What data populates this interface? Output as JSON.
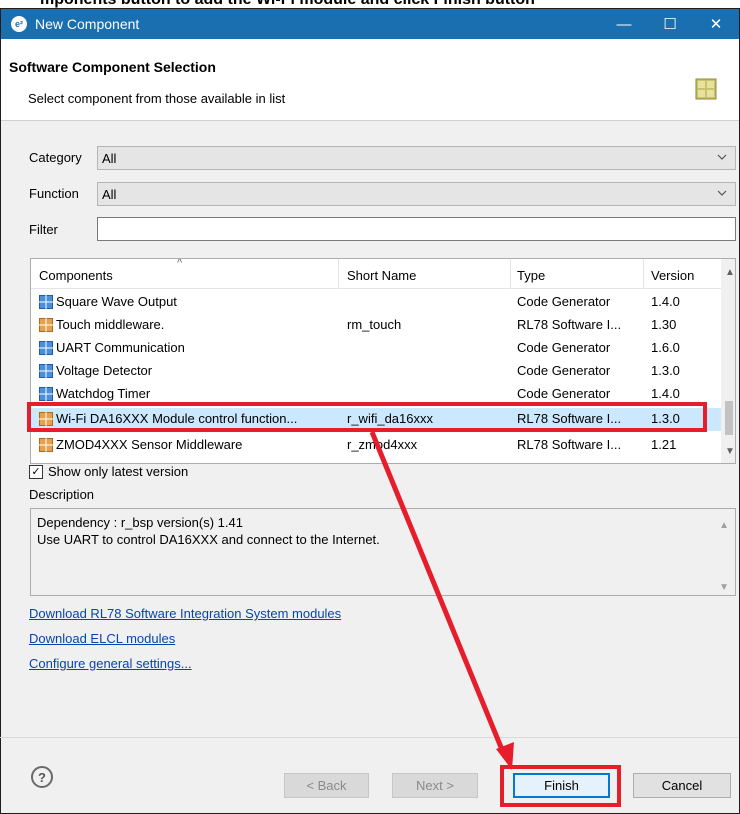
{
  "caption": "mponents button to add the Wi-Fi module and click Finish button",
  "window": {
    "title": "New Component",
    "app_icon_text": "e²",
    "minimize": "—",
    "maximize": "☐",
    "close": "✕"
  },
  "header": {
    "title": "Software Component Selection",
    "subtitle": "Select component from those available in list"
  },
  "filters": {
    "category_label": "Category",
    "category_value": "All",
    "function_label": "Function",
    "function_value": "All",
    "filter_label": "Filter",
    "filter_value": ""
  },
  "table": {
    "columns": [
      "Components",
      "Short Name",
      "Type",
      "Version"
    ],
    "rows": [
      {
        "name": "Square Wave Output",
        "short": "",
        "type": "Code Generator",
        "version": "1.4.0",
        "icon": "grid-blue-icon"
      },
      {
        "name": "Touch middleware.",
        "short": "rm_touch",
        "type": "RL78 Software I...",
        "version": "1.30",
        "icon": "grid-orange-icon"
      },
      {
        "name": "UART Communication",
        "short": "",
        "type": "Code Generator",
        "version": "1.6.0",
        "icon": "grid-blue-icon"
      },
      {
        "name": "Voltage Detector",
        "short": "",
        "type": "Code Generator",
        "version": "1.3.0",
        "icon": "grid-blue-icon"
      },
      {
        "name": "Watchdog Timer",
        "short": "",
        "type": "Code Generator",
        "version": "1.4.0",
        "icon": "grid-blue-icon"
      },
      {
        "name": "Wi-Fi DA16XXX Module control function...",
        "short": "r_wifi_da16xxx",
        "type": "RL78 Software I...",
        "version": "1.3.0",
        "icon": "grid-orange-icon",
        "selected": true
      },
      {
        "name": "ZMOD4XXX Sensor Middleware",
        "short": "r_zmod4xxx",
        "type": "RL78 Software I...",
        "version": "1.21",
        "icon": "grid-orange-icon"
      }
    ]
  },
  "show_latest": {
    "label": "Show only latest version",
    "checked": true
  },
  "description": {
    "label": "Description",
    "line1": "Dependency : r_bsp version(s) 1.41",
    "line2": "Use UART to control DA16XXX and connect to the Internet."
  },
  "links": [
    "Download RL78 Software Integration System modules",
    "Download ELCL modules",
    "Configure general settings..."
  ],
  "buttons": {
    "help": "?",
    "back": "< Back",
    "next": "Next >",
    "finish": "Finish",
    "cancel": "Cancel"
  },
  "colors": {
    "titlebar": "#1a6fb0",
    "annotation": "#e61d2b",
    "selection": "#cce8ff"
  }
}
